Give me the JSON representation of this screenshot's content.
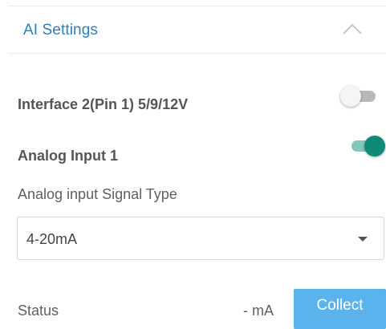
{
  "section": {
    "title": "AI Settings",
    "collapse_icon": "chevron-up-icon"
  },
  "interface2": {
    "label": "Interface 2(Pin 1) 5/9/12V",
    "enabled": false
  },
  "analog_input1": {
    "label": "Analog Input 1",
    "enabled": true
  },
  "signal_type": {
    "label": "Analog input Signal Type",
    "selected": "4-20mA",
    "dropdown_icon": "caret-down-icon"
  },
  "status": {
    "label": "Status",
    "value": "- mA"
  },
  "collect": {
    "label": "Collect"
  },
  "colors": {
    "accent_blue": "#2d7fb9",
    "toggle_on": "#0e8a76",
    "button_blue": "#5ab3ec"
  }
}
